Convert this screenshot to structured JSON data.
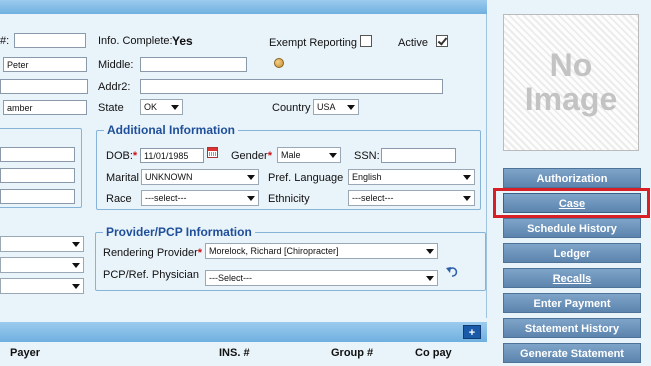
{
  "demographics": {
    "acct_label_fragment": "#:",
    "info_complete_label": "Info. Complete:",
    "info_complete_value": "Yes",
    "exempt_reporting_label": "Exempt Reporting",
    "exempt_reporting_checked": false,
    "active_label": "Active",
    "active_checked": true,
    "first_name_value": "Peter",
    "middle_label": "Middle:",
    "middle_value": "",
    "addr2_label": "Addr2:",
    "addr2_value": "",
    "city_value": "amber",
    "state_label": "State",
    "state_value": "OK",
    "country_label": "Country",
    "country_value": "USA"
  },
  "additional_info": {
    "legend": "Additional Information",
    "dob_label": "DOB:",
    "dob_value": "11/01/1985",
    "gender_label": "Gender",
    "gender_value": "Male",
    "ssn_label": "SSN:",
    "ssn_value": "",
    "marital_label": "Marital",
    "marital_value": "UNKNOWN",
    "pref_language_label": "Pref. Language",
    "pref_language_value": "English",
    "race_label": "Race",
    "race_value": "---select---",
    "ethnicity_label": "Ethnicity",
    "ethnicity_value": "---select---"
  },
  "provider": {
    "legend": "Provider/PCP Information",
    "rendering_label": "Rendering Provider",
    "rendering_value": "Morelock, Richard [Chiropracter]",
    "pcp_label": "PCP/Ref. Physician",
    "pcp_value": "---Select---"
  },
  "insurance_table": {
    "add_label": "+",
    "columns": [
      "Payer",
      "INS. #",
      "Group #",
      "Co pay"
    ]
  },
  "photo": {
    "line1": "No",
    "line2": "Image"
  },
  "side_buttons": [
    {
      "label": "Authorization"
    },
    {
      "label": "Case",
      "highlighted": true
    },
    {
      "label": "Schedule History"
    },
    {
      "label": "Ledger"
    },
    {
      "label": "Recalls"
    },
    {
      "label": "Enter Payment"
    },
    {
      "label": "Statement History"
    },
    {
      "label": "Generate Statement"
    }
  ],
  "colors": {
    "header_bar": "#74b3e3",
    "legend_text": "#1f4f99",
    "button_fill": "#6b93bb",
    "highlight_border": "#d81f26"
  }
}
